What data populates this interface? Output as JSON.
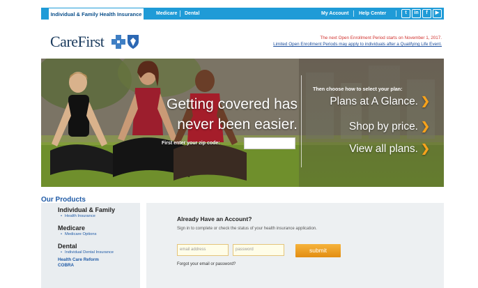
{
  "nav": {
    "tab_individual": "Individual & Family Health Insurance",
    "medicare": "Medicare",
    "dental": "Dental",
    "my_account": "My Account",
    "help_center": "Help Center",
    "social": [
      "twitter-icon",
      "linkedin-icon",
      "facebook-icon",
      "youtube-icon"
    ]
  },
  "header": {
    "logo_text": "CareFirst",
    "enroll_line1": "The next Open Enrollment Period starts on November 1, 2017.",
    "enroll_line2": "Limited Open Enrollment Periods may apply to individuals after a Qualifying Life Event."
  },
  "hero": {
    "tagline_line1": "Getting covered has",
    "tagline_line2": "never been easier.",
    "zip_label": "First enter your zip code:",
    "choose_label": "Then choose how to select your plan:",
    "plans": [
      "Plans at A Glance.",
      "Shop by price.",
      "View all plans."
    ]
  },
  "products": {
    "title": "Our Products",
    "groups": [
      {
        "heading": "Individual & Family",
        "item": "Health Insurance"
      },
      {
        "heading": "Medicare",
        "item": "Medicare Options"
      },
      {
        "heading": "Dental",
        "item": "Individual Dental Insurance"
      }
    ],
    "links": [
      "Health Care Reform",
      "COBRA"
    ]
  },
  "account": {
    "title": "Already Have an Account?",
    "description": "Sign in to complete or check the status of your health insurance application.",
    "email_placeholder": "email address",
    "password_placeholder": "password",
    "submit_label": "submit",
    "forgot_link": "Forgot your email or password?"
  },
  "colors": {
    "nav_blue": "#1f9bd7",
    "accent_orange": "#f7a21b",
    "brand_navy": "#1a3a5c",
    "alert_red": "#d0312d"
  }
}
